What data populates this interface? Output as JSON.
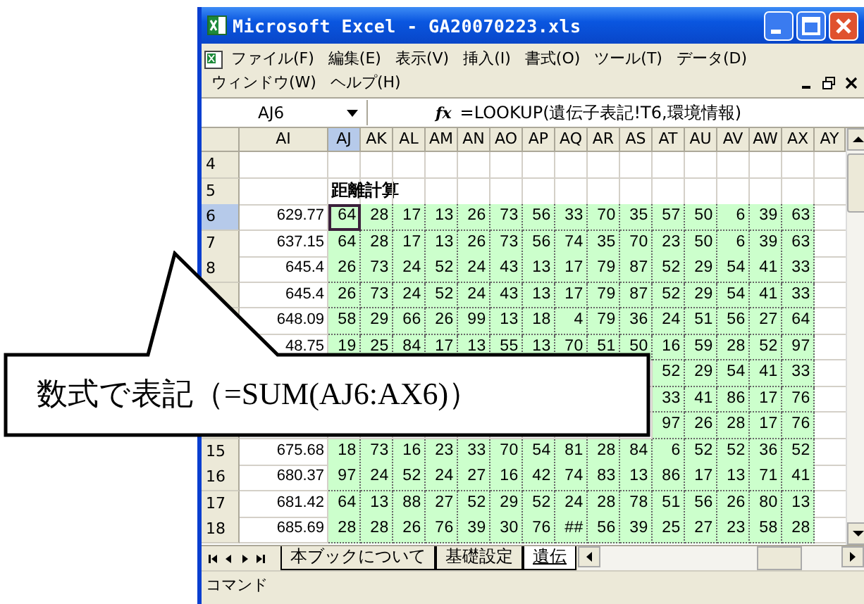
{
  "window": {
    "title": "Microsoft Excel - GA20070223.xls"
  },
  "menu": [
    "ファイル(F)",
    "編集(E)",
    "表示(V)",
    "挿入(I)",
    "書式(O)",
    "ツール(T)",
    "データ(D)",
    "ウィンドウ(W)",
    "ヘルプ(H)"
  ],
  "formula_bar": {
    "name_box": "AJ6",
    "fx": "fx",
    "formula": "=LOOKUP(遺伝子表記!T6,環境情報)"
  },
  "columns": [
    {
      "label": "AI",
      "selected": false
    },
    {
      "label": "AJ",
      "selected": true
    },
    {
      "label": "AK",
      "selected": false
    },
    {
      "label": "AL",
      "selected": false
    },
    {
      "label": "AM",
      "selected": false
    },
    {
      "label": "AN",
      "selected": false
    },
    {
      "label": "AO",
      "selected": false
    },
    {
      "label": "AP",
      "selected": false
    },
    {
      "label": "AQ",
      "selected": false
    },
    {
      "label": "AR",
      "selected": false
    },
    {
      "label": "AS",
      "selected": false
    },
    {
      "label": "AT",
      "selected": false
    },
    {
      "label": "AU",
      "selected": false
    },
    {
      "label": "AV",
      "selected": false
    },
    {
      "label": "AW",
      "selected": false
    },
    {
      "label": "AX",
      "selected": false
    },
    {
      "label": "AY",
      "selected": false
    }
  ],
  "rows": [
    {
      "label": "4",
      "selected": false
    },
    {
      "label": "5",
      "selected": false,
      "heading": "距離計算"
    },
    {
      "label": "6",
      "selected": true,
      "ai": "629.77",
      "cells": [
        "64",
        "28",
        "17",
        "13",
        "26",
        "73",
        "56",
        "33",
        "70",
        "35",
        "57",
        "50",
        "6",
        "39",
        "63"
      ]
    },
    {
      "label": "7",
      "selected": false,
      "ai": "637.15",
      "cells": [
        "64",
        "28",
        "17",
        "13",
        "26",
        "73",
        "56",
        "74",
        "35",
        "70",
        "23",
        "50",
        "6",
        "39",
        "63"
      ]
    },
    {
      "label": "8",
      "selected": false,
      "ai": "645.4",
      "cells": [
        "26",
        "73",
        "24",
        "52",
        "24",
        "43",
        "13",
        "17",
        "79",
        "87",
        "52",
        "29",
        "54",
        "41",
        "33"
      ]
    },
    {
      "ai": "645.4",
      "cells": [
        "26",
        "73",
        "24",
        "52",
        "24",
        "43",
        "13",
        "17",
        "79",
        "87",
        "52",
        "29",
        "54",
        "41",
        "33"
      ]
    },
    {
      "ai": "648.09",
      "cells": [
        "58",
        "29",
        "66",
        "26",
        "99",
        "13",
        "18",
        "4",
        "79",
        "36",
        "24",
        "51",
        "56",
        "27",
        "64"
      ]
    },
    {
      "ai": "48.75",
      "cells": [
        "19",
        "25",
        "84",
        "17",
        "13",
        "55",
        "13",
        "70",
        "51",
        "50",
        "16",
        "59",
        "28",
        "52",
        "97"
      ]
    },
    {
      "cells": [
        "52",
        "29",
        "54",
        "41",
        "33"
      ]
    },
    {
      "cells": [
        "33",
        "41",
        "86",
        "17",
        "76"
      ]
    },
    {
      "cells": [
        "97",
        "26",
        "28",
        "17",
        "76"
      ]
    },
    {
      "label": "15",
      "selected": false,
      "ai": "675.68",
      "cells": [
        "18",
        "73",
        "16",
        "23",
        "33",
        "70",
        "54",
        "81",
        "28",
        "84",
        "6",
        "52",
        "52",
        "36",
        "52"
      ]
    },
    {
      "label": "16",
      "selected": false,
      "ai": "680.37",
      "cells": [
        "97",
        "24",
        "52",
        "24",
        "27",
        "16",
        "42",
        "74",
        "83",
        "13",
        "86",
        "17",
        "13",
        "71",
        "41"
      ]
    },
    {
      "label": "17",
      "selected": false,
      "ai": "681.42",
      "cells": [
        "64",
        "13",
        "88",
        "27",
        "52",
        "29",
        "52",
        "24",
        "28",
        "78",
        "51",
        "56",
        "26",
        "80",
        "13"
      ]
    },
    {
      "label": "18",
      "selected": false,
      "ai": "685.69",
      "cells": [
        "28",
        "28",
        "26",
        "76",
        "39",
        "30",
        "76",
        "##",
        "56",
        "39",
        "25",
        "27",
        "23",
        "58",
        "28"
      ]
    }
  ],
  "sheet_tabs": [
    {
      "label": "本ブックについて",
      "selected": false
    },
    {
      "label": "基礎設定",
      "selected": false
    },
    {
      "label": "遺伝",
      "selected": true
    }
  ],
  "status_bar": "コマンド",
  "callout": "数式で表記（=SUM(AJ6:AX6)）"
}
